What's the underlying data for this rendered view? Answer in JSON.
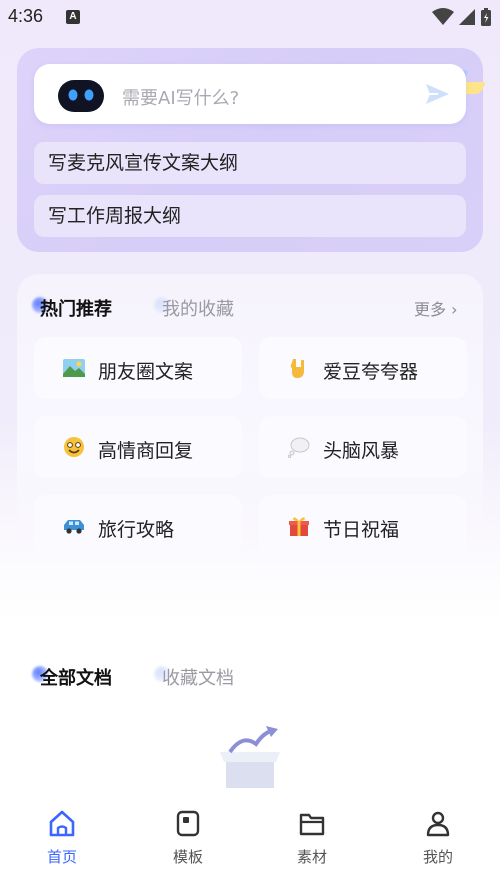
{
  "status_bar": {
    "time": "4:36",
    "notif_badge": "A"
  },
  "ai_box": {
    "placeholder": "需要AI写什么?",
    "suggestions": [
      "写麦克风宣传文案大纲",
      "写工作周报大纲"
    ]
  },
  "hot_section": {
    "tabs": [
      "热门推荐",
      "我的收藏"
    ],
    "more": "更多 ›",
    "tiles": [
      {
        "label": "朋友圈文案",
        "icon": "landscape-photo-icon"
      },
      {
        "label": "爱豆夸夸器",
        "icon": "rock-hand-icon"
      },
      {
        "label": "高情商回复",
        "icon": "smile-emoji-icon"
      },
      {
        "label": "头脑风暴",
        "icon": "thought-bubble-icon"
      },
      {
        "label": "旅行攻略",
        "icon": "car-icon"
      },
      {
        "label": "节日祝福",
        "icon": "gift-icon"
      }
    ]
  },
  "docs_section": {
    "tabs": [
      "全部文档",
      "收藏文档"
    ]
  },
  "nav": {
    "items": [
      {
        "label": "首页",
        "icon": "home-icon"
      },
      {
        "label": "模板",
        "icon": "template-icon"
      },
      {
        "label": "素材",
        "icon": "folder-icon"
      },
      {
        "label": "我的",
        "icon": "person-icon"
      }
    ]
  },
  "colors": {
    "accent": "#3b66ff",
    "card_purple": "#d8cff9"
  }
}
